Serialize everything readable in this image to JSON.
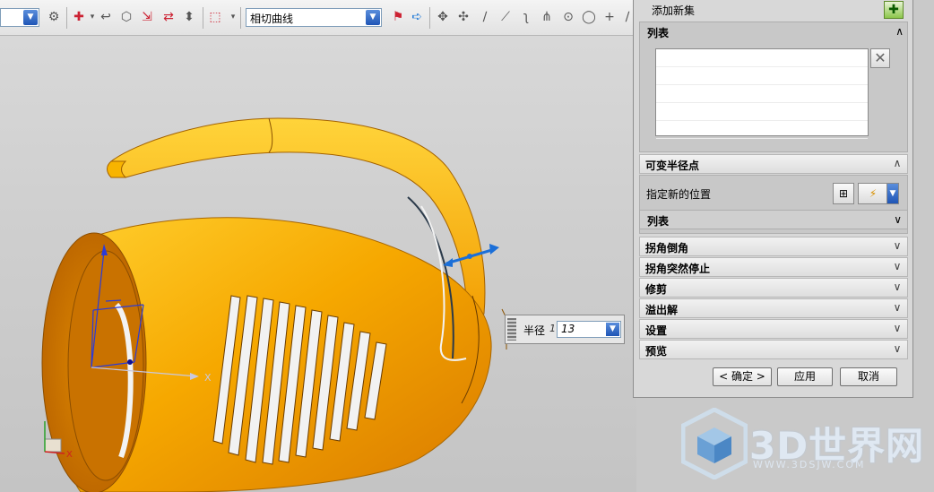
{
  "toolbar": {
    "left_combo_value": "",
    "curve_combo_value": "相切曲线",
    "icons": [
      "snap-icon",
      "undo-icon",
      "box-icon",
      "point-add-icon",
      "point-move-icon",
      "pattern-icon",
      "select-rect-icon",
      "dropdown-icon",
      "info-icon",
      "arrow-right-icon",
      "move-icon",
      "transform-icon",
      "line-icon",
      "tangent-line-icon",
      "curve-icon",
      "arc-icon",
      "circle-point-icon",
      "circle-icon",
      "cross-icon"
    ]
  },
  "viewport": {
    "radius_label": "半径",
    "radius_index": "1",
    "radius_value": "13",
    "axis_x": "X",
    "triad_x": "X"
  },
  "panel": {
    "add_new_set": "添加新集",
    "list_title": "列表",
    "list_rows": [
      "",
      "",
      "",
      "",
      ""
    ],
    "var_radius_section": "可变半径点",
    "specify_new_position": "指定新的位置",
    "sub_list_title": "列表",
    "sections": [
      "拐角倒角",
      "拐角突然停止",
      "修剪",
      "溢出解",
      "设置",
      "预览"
    ],
    "ok_label": "< 确定 >",
    "apply_label": "应用",
    "cancel_label": "取消"
  },
  "watermark": {
    "brand": "3D世界网",
    "url": "WWW.3DSJW.COM"
  },
  "colors": {
    "part_orange": "#f6a800",
    "header_blue": "#1f55b6",
    "handle_blue": "#1b6fd8"
  }
}
